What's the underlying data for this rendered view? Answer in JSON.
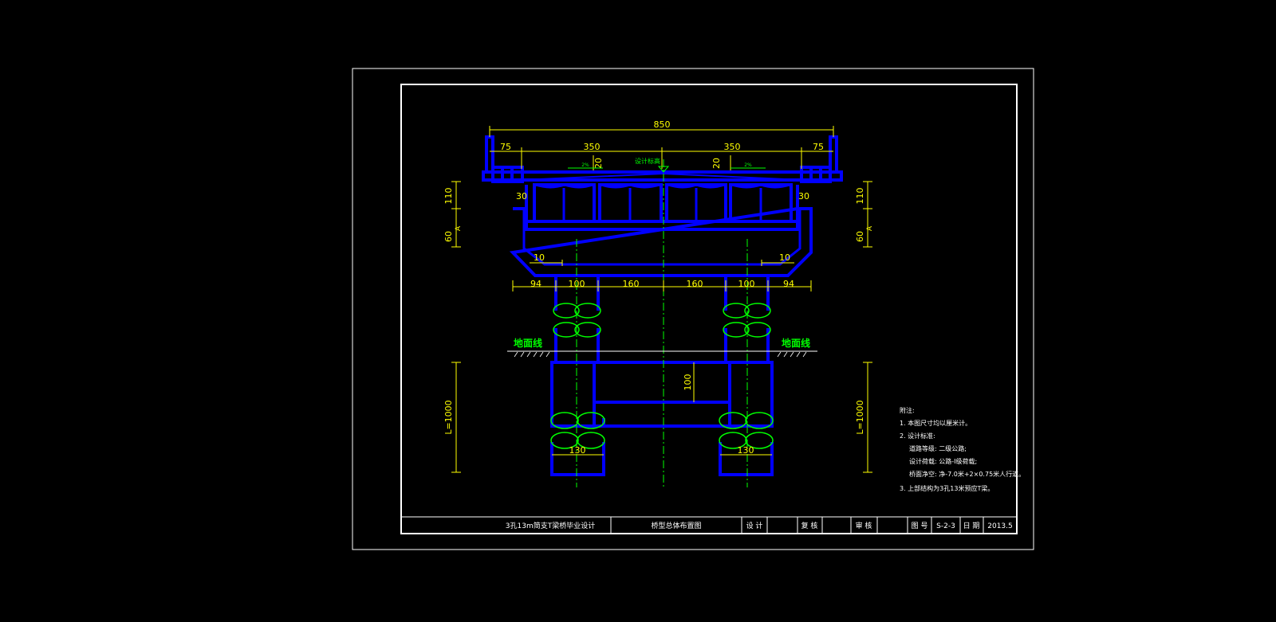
{
  "drawing": {
    "dims": {
      "total_width": "850",
      "half_width_left": "350",
      "half_width_right": "350",
      "sidewalk_left": "75",
      "sidewalk_right": "75",
      "curb_left": "20",
      "curb_right": "20",
      "edge_left": "30",
      "edge_right": "30",
      "cap_depth_left": "110",
      "cap_depth_right": "110",
      "cap_bottom_left": "60",
      "cap_bottom_right": "60",
      "taper_left": "10",
      "taper_right": "10",
      "cap_ov_left": "94",
      "col_left": "100",
      "spacing_left": "160",
      "spacing_right": "160",
      "col_right": "100",
      "cap_ov_right": "94",
      "tie_beam": "100",
      "pile_left": "130",
      "pile_right": "130",
      "pile_len_left": "L=1000",
      "pile_len_right": "L=1000"
    },
    "labels": {
      "slope_left": "2%",
      "slope_right": "2%",
      "design_elev": "设计标高",
      "ground_left": "地面线",
      "ground_right": "地面线",
      "section_mark_left": "A",
      "section_mark_right": "A"
    },
    "notes": {
      "heading": "附注:",
      "items": [
        "1. 本图尺寸均以厘米计。",
        "2. 设计标准:",
        "道路等级: 二级公路;",
        "设计荷载: 公路-I级荷载;",
        "桥面净空: 净-7.0米+2×0.75米人行道。",
        "3. 上部结构为3孔13米预应T梁。"
      ]
    },
    "title_block": {
      "project": "3孔13m简支T梁桥毕业设计",
      "drawing_title": "桥型总体布置图",
      "design_label": "设 计",
      "check_label": "复 核",
      "review_label": "审 核",
      "sheet_label": "图 号",
      "sheet_no": "S-2-3",
      "date_label": "日 期",
      "date": "2013.5"
    },
    "colors": {
      "structure": "#0000ff",
      "dimension": "#ffff00",
      "centerline": "#00ff00",
      "annotation": "#00ff00",
      "frame": "#ffffff",
      "background": "#000000"
    }
  }
}
